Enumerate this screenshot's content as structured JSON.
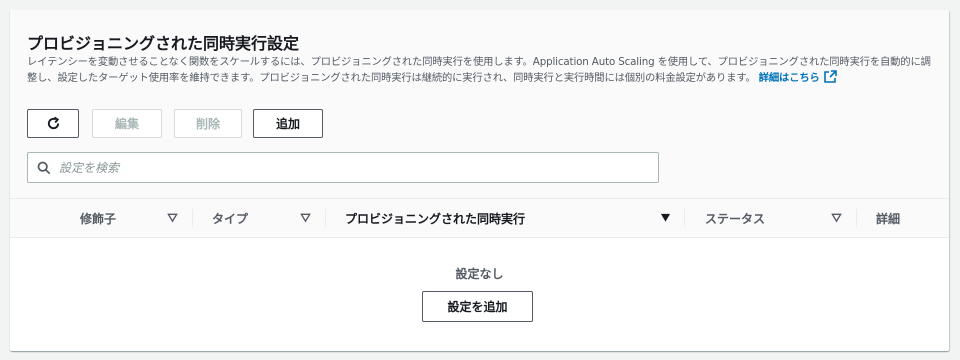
{
  "panel": {
    "title": "プロビジョニングされた同時実行設定",
    "description": "レイテンシーを変動させることなく関数をスケールするには、プロビジョニングされた同時実行を使用します。Application Auto Scaling を使用して、プロビジョニングされた同時実行を自動的に調整し、設定したターゲット使用率を維持できます。プロビジョニングされた同時実行は継続的に実行され、同時実行と実行時間には個別の料金設定があります。",
    "details_link": "詳細はこちら",
    "external_link_icon": "external-link-icon"
  },
  "toolbar": {
    "refresh_icon": "refresh-icon",
    "edit_label": "編集",
    "delete_label": "削除",
    "add_label": "追加"
  },
  "search": {
    "placeholder": "設定を検索",
    "value": ""
  },
  "table": {
    "columns": [
      {
        "label": "修飾子",
        "sort": "unsorted"
      },
      {
        "label": "タイプ",
        "sort": "unsorted"
      },
      {
        "label": "プロビジョニングされた同時実行",
        "sort": "descending"
      },
      {
        "label": "ステータス",
        "sort": "unsorted"
      },
      {
        "label": "詳細",
        "sort": "none"
      }
    ],
    "rows": [],
    "empty_text": "設定なし",
    "empty_action_label": "設定を追加"
  },
  "colors": {
    "link": "#0073bb",
    "border": "#545b64",
    "disabled": "#aab7b8",
    "background": "#f2f3f3"
  }
}
